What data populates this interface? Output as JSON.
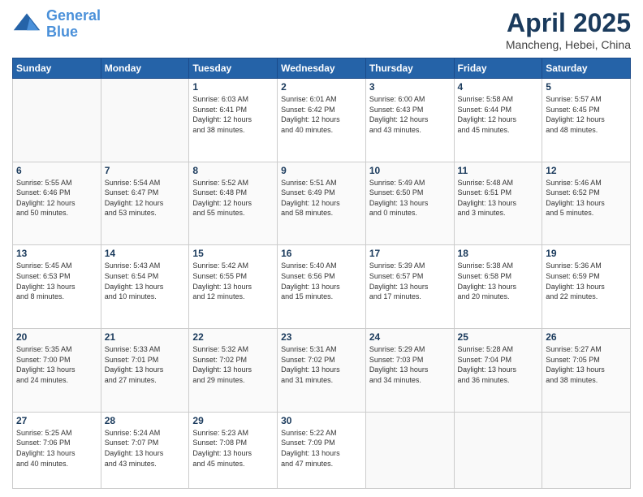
{
  "logo": {
    "line1": "General",
    "line2": "Blue"
  },
  "title": "April 2025",
  "location": "Mancheng, Hebei, China",
  "weekdays": [
    "Sunday",
    "Monday",
    "Tuesday",
    "Wednesday",
    "Thursday",
    "Friday",
    "Saturday"
  ],
  "weeks": [
    [
      {
        "num": "",
        "info": ""
      },
      {
        "num": "",
        "info": ""
      },
      {
        "num": "1",
        "info": "Sunrise: 6:03 AM\nSunset: 6:41 PM\nDaylight: 12 hours\nand 38 minutes."
      },
      {
        "num": "2",
        "info": "Sunrise: 6:01 AM\nSunset: 6:42 PM\nDaylight: 12 hours\nand 40 minutes."
      },
      {
        "num": "3",
        "info": "Sunrise: 6:00 AM\nSunset: 6:43 PM\nDaylight: 12 hours\nand 43 minutes."
      },
      {
        "num": "4",
        "info": "Sunrise: 5:58 AM\nSunset: 6:44 PM\nDaylight: 12 hours\nand 45 minutes."
      },
      {
        "num": "5",
        "info": "Sunrise: 5:57 AM\nSunset: 6:45 PM\nDaylight: 12 hours\nand 48 minutes."
      }
    ],
    [
      {
        "num": "6",
        "info": "Sunrise: 5:55 AM\nSunset: 6:46 PM\nDaylight: 12 hours\nand 50 minutes."
      },
      {
        "num": "7",
        "info": "Sunrise: 5:54 AM\nSunset: 6:47 PM\nDaylight: 12 hours\nand 53 minutes."
      },
      {
        "num": "8",
        "info": "Sunrise: 5:52 AM\nSunset: 6:48 PM\nDaylight: 12 hours\nand 55 minutes."
      },
      {
        "num": "9",
        "info": "Sunrise: 5:51 AM\nSunset: 6:49 PM\nDaylight: 12 hours\nand 58 minutes."
      },
      {
        "num": "10",
        "info": "Sunrise: 5:49 AM\nSunset: 6:50 PM\nDaylight: 13 hours\nand 0 minutes."
      },
      {
        "num": "11",
        "info": "Sunrise: 5:48 AM\nSunset: 6:51 PM\nDaylight: 13 hours\nand 3 minutes."
      },
      {
        "num": "12",
        "info": "Sunrise: 5:46 AM\nSunset: 6:52 PM\nDaylight: 13 hours\nand 5 minutes."
      }
    ],
    [
      {
        "num": "13",
        "info": "Sunrise: 5:45 AM\nSunset: 6:53 PM\nDaylight: 13 hours\nand 8 minutes."
      },
      {
        "num": "14",
        "info": "Sunrise: 5:43 AM\nSunset: 6:54 PM\nDaylight: 13 hours\nand 10 minutes."
      },
      {
        "num": "15",
        "info": "Sunrise: 5:42 AM\nSunset: 6:55 PM\nDaylight: 13 hours\nand 12 minutes."
      },
      {
        "num": "16",
        "info": "Sunrise: 5:40 AM\nSunset: 6:56 PM\nDaylight: 13 hours\nand 15 minutes."
      },
      {
        "num": "17",
        "info": "Sunrise: 5:39 AM\nSunset: 6:57 PM\nDaylight: 13 hours\nand 17 minutes."
      },
      {
        "num": "18",
        "info": "Sunrise: 5:38 AM\nSunset: 6:58 PM\nDaylight: 13 hours\nand 20 minutes."
      },
      {
        "num": "19",
        "info": "Sunrise: 5:36 AM\nSunset: 6:59 PM\nDaylight: 13 hours\nand 22 minutes."
      }
    ],
    [
      {
        "num": "20",
        "info": "Sunrise: 5:35 AM\nSunset: 7:00 PM\nDaylight: 13 hours\nand 24 minutes."
      },
      {
        "num": "21",
        "info": "Sunrise: 5:33 AM\nSunset: 7:01 PM\nDaylight: 13 hours\nand 27 minutes."
      },
      {
        "num": "22",
        "info": "Sunrise: 5:32 AM\nSunset: 7:02 PM\nDaylight: 13 hours\nand 29 minutes."
      },
      {
        "num": "23",
        "info": "Sunrise: 5:31 AM\nSunset: 7:02 PM\nDaylight: 13 hours\nand 31 minutes."
      },
      {
        "num": "24",
        "info": "Sunrise: 5:29 AM\nSunset: 7:03 PM\nDaylight: 13 hours\nand 34 minutes."
      },
      {
        "num": "25",
        "info": "Sunrise: 5:28 AM\nSunset: 7:04 PM\nDaylight: 13 hours\nand 36 minutes."
      },
      {
        "num": "26",
        "info": "Sunrise: 5:27 AM\nSunset: 7:05 PM\nDaylight: 13 hours\nand 38 minutes."
      }
    ],
    [
      {
        "num": "27",
        "info": "Sunrise: 5:25 AM\nSunset: 7:06 PM\nDaylight: 13 hours\nand 40 minutes."
      },
      {
        "num": "28",
        "info": "Sunrise: 5:24 AM\nSunset: 7:07 PM\nDaylight: 13 hours\nand 43 minutes."
      },
      {
        "num": "29",
        "info": "Sunrise: 5:23 AM\nSunset: 7:08 PM\nDaylight: 13 hours\nand 45 minutes."
      },
      {
        "num": "30",
        "info": "Sunrise: 5:22 AM\nSunset: 7:09 PM\nDaylight: 13 hours\nand 47 minutes."
      },
      {
        "num": "",
        "info": ""
      },
      {
        "num": "",
        "info": ""
      },
      {
        "num": "",
        "info": ""
      }
    ]
  ]
}
